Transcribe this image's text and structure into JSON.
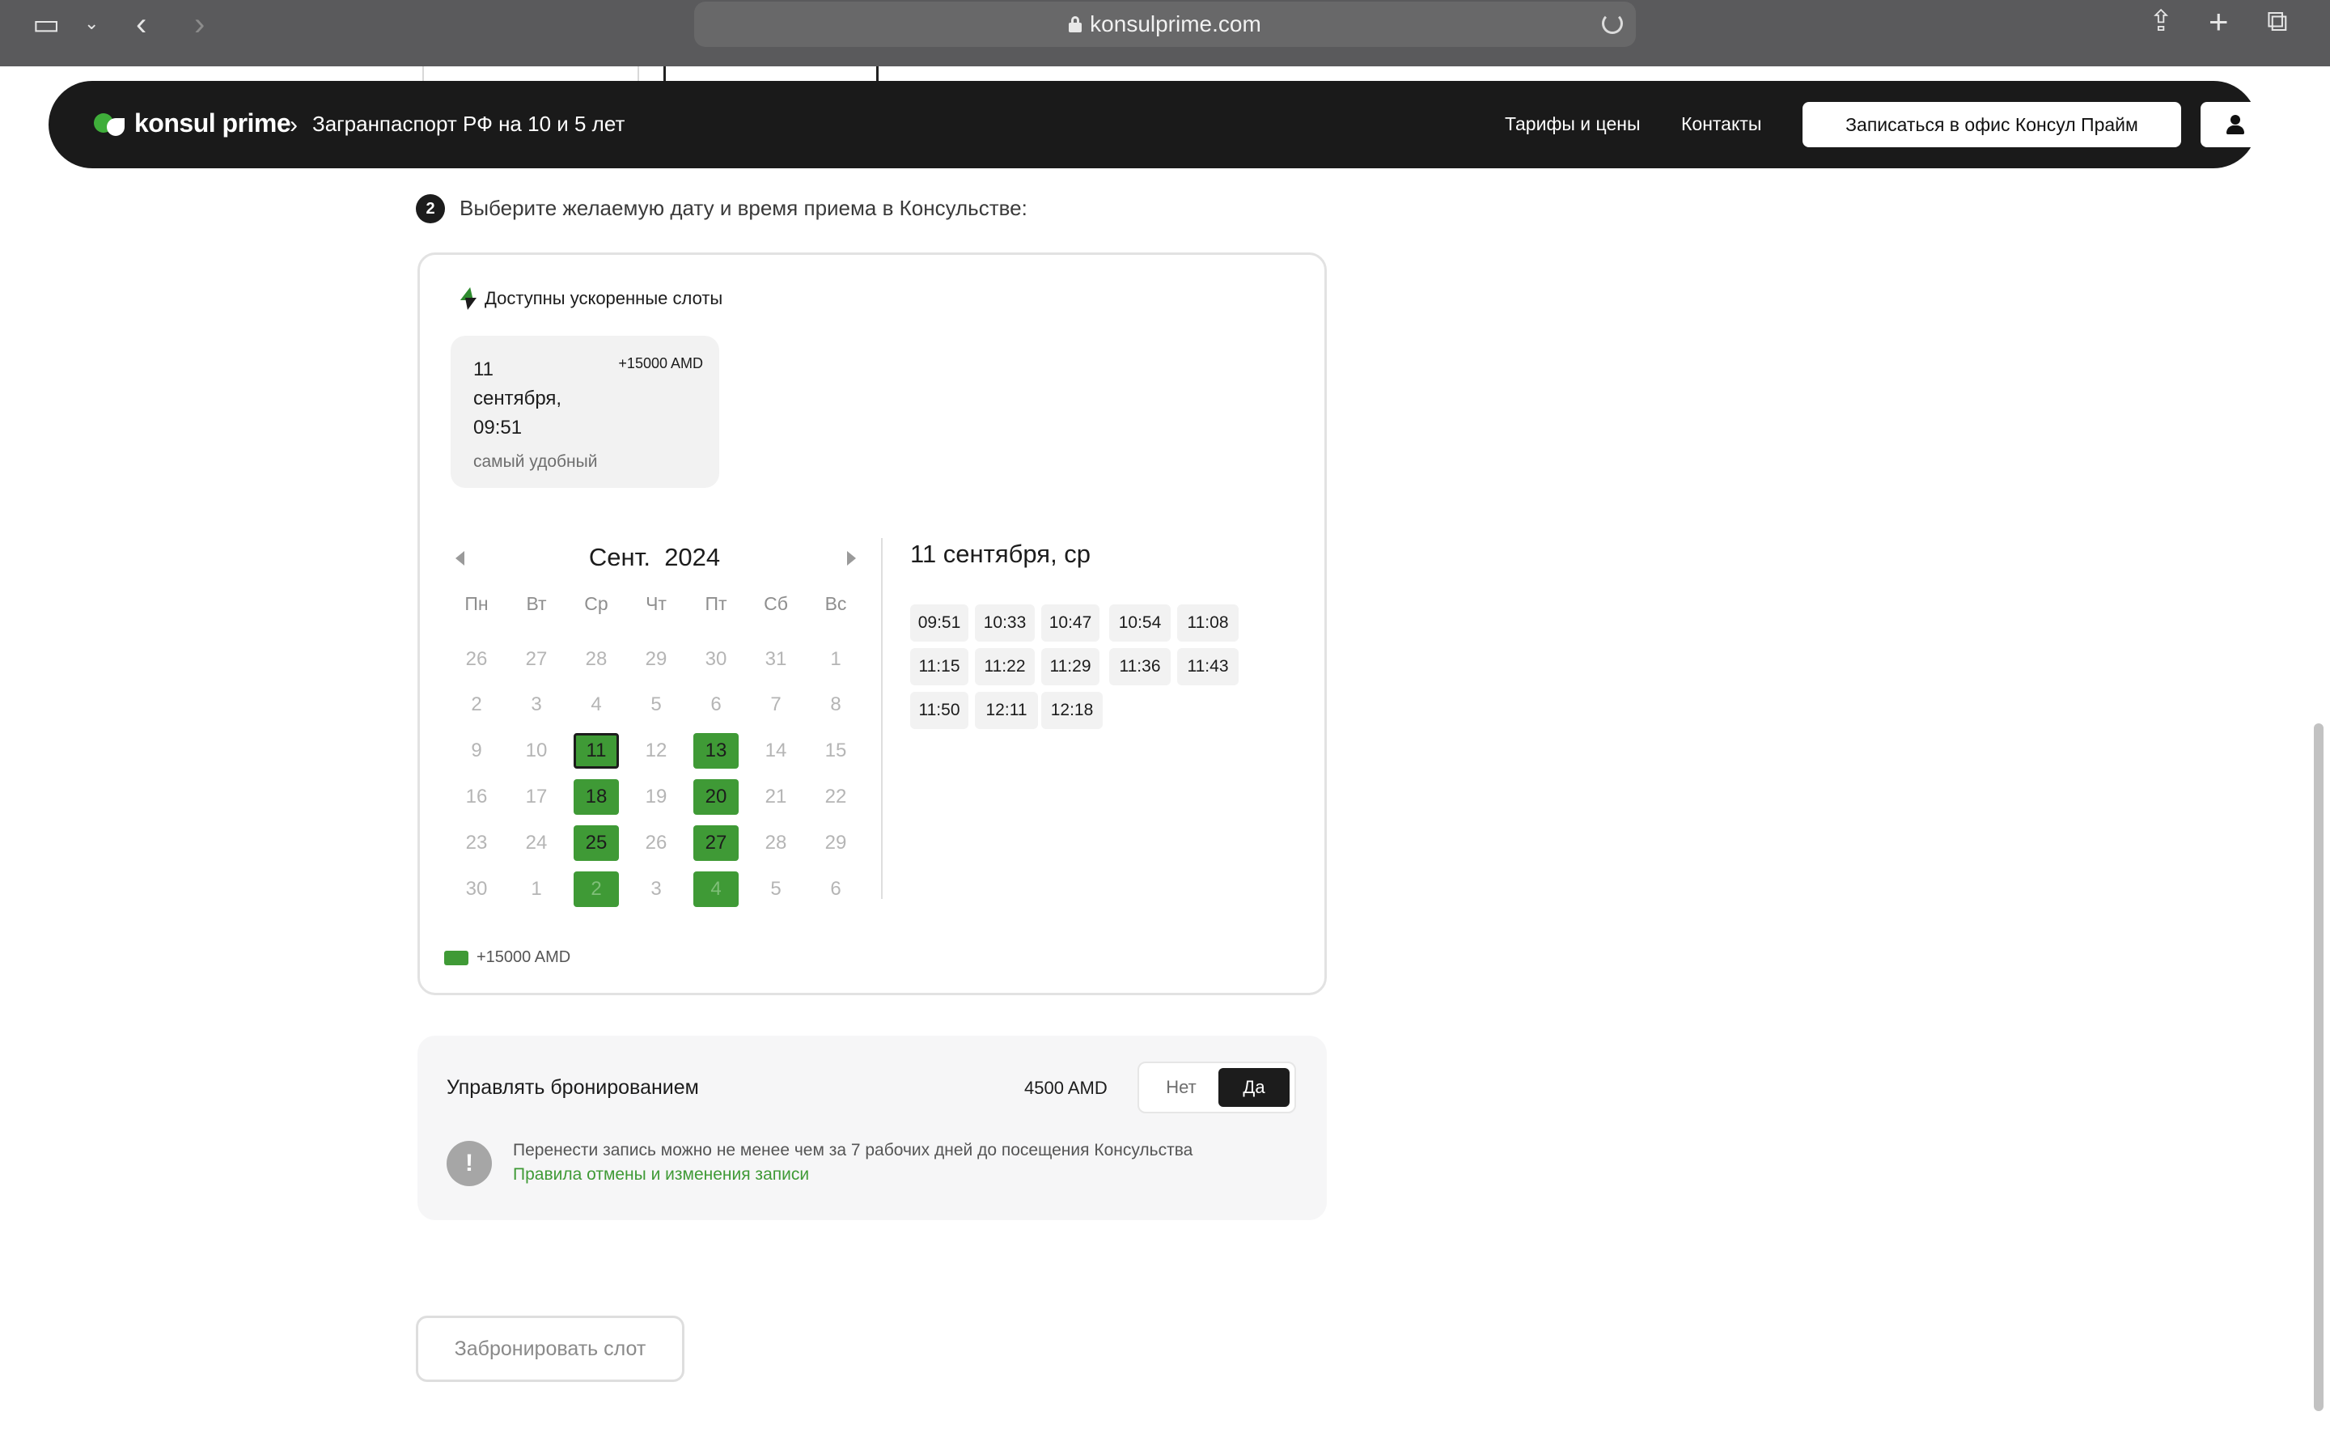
{
  "browser": {
    "url": "konsulprime.com"
  },
  "header": {
    "logo": "konsul prime",
    "breadcrumb": "Загранпаспорт РФ на 10 и 5 лет",
    "nav_tariffs": "Тарифы и цены",
    "nav_contacts": "Контакты",
    "cta": "Записаться в офис Консул Прайм"
  },
  "step": {
    "number": "2",
    "title": "Выберите желаемую дату и время приема в Консульстве:"
  },
  "fast_slots": {
    "title": "Доступны ускоренные слоты",
    "slot": {
      "date_line1": "11",
      "date_line2": "сентября,",
      "date_line3": "09:51",
      "price": "+15000 AMD",
      "note": "самый удобный"
    }
  },
  "calendar": {
    "month": "Сент.",
    "year": "2024",
    "weekdays": [
      "Пн",
      "Вт",
      "Ср",
      "Чт",
      "Пт",
      "Сб",
      "Вс"
    ],
    "weeks": [
      [
        "26",
        "27",
        "28",
        "29",
        "30",
        "31",
        "1"
      ],
      [
        "2",
        "3",
        "4",
        "5",
        "6",
        "7",
        "8"
      ],
      [
        "9",
        "10",
        "11",
        "12",
        "13",
        "14",
        "15"
      ],
      [
        "16",
        "17",
        "18",
        "19",
        "20",
        "21",
        "22"
      ],
      [
        "23",
        "24",
        "25",
        "26",
        "27",
        "28",
        "29"
      ],
      [
        "30",
        "1",
        "2",
        "3",
        "4",
        "5",
        "6"
      ]
    ],
    "available_days": [
      "11",
      "13",
      "18",
      "20",
      "25",
      "27"
    ],
    "selected_day": "11",
    "legend": "+15000 AMD",
    "accent_color": "#3f9a36"
  },
  "times": {
    "title": "11 сентября, ср",
    "slots": [
      "09:51",
      "10:33",
      "10:47",
      "10:54",
      "11:08",
      "11:15",
      "11:22",
      "11:29",
      "11:36",
      "11:43",
      "11:50",
      "12:11",
      "12:18"
    ]
  },
  "manage": {
    "title": "Управлять бронированием",
    "price": "4500 AMD",
    "option_no": "Нет",
    "option_yes": "Да",
    "selected": "Да",
    "info": "Перенести запись можно не менее чем за 7 рабочих дней до посещения Консульства",
    "link": "Правила отмены и изменения записи"
  },
  "book_button": "Забронировать слот"
}
